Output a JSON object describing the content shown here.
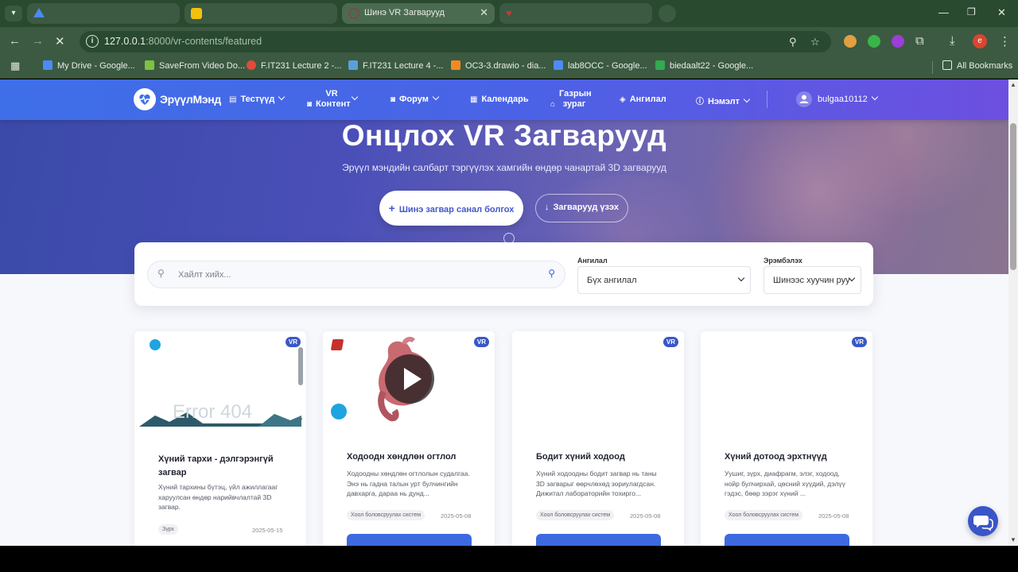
{
  "browser": {
    "tabs": [
      {
        "title": "",
        "favicon_color": "#4c8bf5"
      },
      {
        "title": "",
        "favicon_color": "#f4c20d"
      },
      {
        "title": "Шинэ VR Загварууд",
        "favicon_color": "#7a4a4a"
      },
      {
        "title": "",
        "favicon_color": "#c03a3a"
      }
    ],
    "url_host": "127.0.0.1",
    "url_rest": ":8000/vr-contents/featured",
    "bookmarks": [
      {
        "label": "My Drive - Google...",
        "color": "#4c8bf5"
      },
      {
        "label": "SaveFrom Video Do...",
        "color": "#7cc142"
      },
      {
        "label": "F.IT231 Lecture 2 -...",
        "color": "#e04a3a"
      },
      {
        "label": "F.IT231 Lecture 4 -...",
        "color": "#5aa0d8"
      },
      {
        "label": "OC3-3.drawio - dia...",
        "color": "#f08a24"
      },
      {
        "label": "lab8OCC - Google...",
        "color": "#4c8bf5"
      },
      {
        "label": "biedaalt22 - Google...",
        "color": "#34a853"
      }
    ],
    "all_bookmarks": "All Bookmarks",
    "profile_initial": "e"
  },
  "nav": {
    "logo": "ЭрүүлМэнд",
    "items": [
      {
        "label": "Тестүүд",
        "icon": "clipboard-icon"
      },
      {
        "label": "VR Контент",
        "icon": "vr-headset-icon"
      },
      {
        "label": "Форум",
        "icon": "chat-icon"
      },
      {
        "label": "Календарь",
        "icon": "calendar-icon"
      },
      {
        "label": "Газрын зураг",
        "icon": "map-icon"
      },
      {
        "label": "Ангилал",
        "icon": "tag-icon"
      },
      {
        "label": "Нэмэлт",
        "icon": "info-icon"
      }
    ],
    "user": "bulgaa10112"
  },
  "hero": {
    "title": "Онцлох VR Загварууд",
    "subtitle": "Эрүүл мэндийн салбарт тэргүүлэх хамгийн өндөр чанартай 3D загварууд",
    "primary_button": "Шинэ загвар санал болгох",
    "secondary_button": "Загварууд үзэх"
  },
  "filters": {
    "search_placeholder": "Хайлт хийх...",
    "category_label": "Ангилал",
    "category_value": "Бүх ангилал",
    "sort_label": "Эрэмбэлэх",
    "sort_value": "Шинээс хуучин руу"
  },
  "cards": [
    {
      "title": "Хүний тархи - дэлгэрэнгүй загвар",
      "desc": "Хүний тархины бүтэц, үйл ажиллагааг харуулсан өндөр нарийвчлалтай 3D загвар.",
      "tag": "Зүрх",
      "date": "2025-05-15",
      "badge": "VR",
      "media_brand": "Sketchfab",
      "media_text": "Error 404"
    },
    {
      "title": "Ходоодн хөндлөн огтлол",
      "desc": "Ходоодны хөндлөн огтлолын судалгаа. Энэ нь гадна талын урт булчингийн давхарга, дараа нь дунд...",
      "tag": "Хоол боловсруулах систем",
      "date": "2025-05-08",
      "badge": "VR",
      "media_price": "$"
    },
    {
      "title": "Бодит хүний ходоод",
      "desc": "Хүний ходоодны бодит загвар нь таны 3D загварыг өөрчлөхөд зориулагдсан. Дижитал лабораторийн тохирго...",
      "tag": "Хоол боловсруулах систем",
      "date": "2025-05-08",
      "badge": "VR"
    },
    {
      "title": "Хүний дотоод эрхтнүүд",
      "desc": "Уушиг, зүрх, диафрагм, элэг, ходоод, нойр булчирхай, цөсний хүүдий, дэлүү гэдэс, бөөр зэрэг хүний ...",
      "tag": "Хоол боловсруулах систем",
      "date": "2025-05-08",
      "badge": "VR"
    }
  ]
}
